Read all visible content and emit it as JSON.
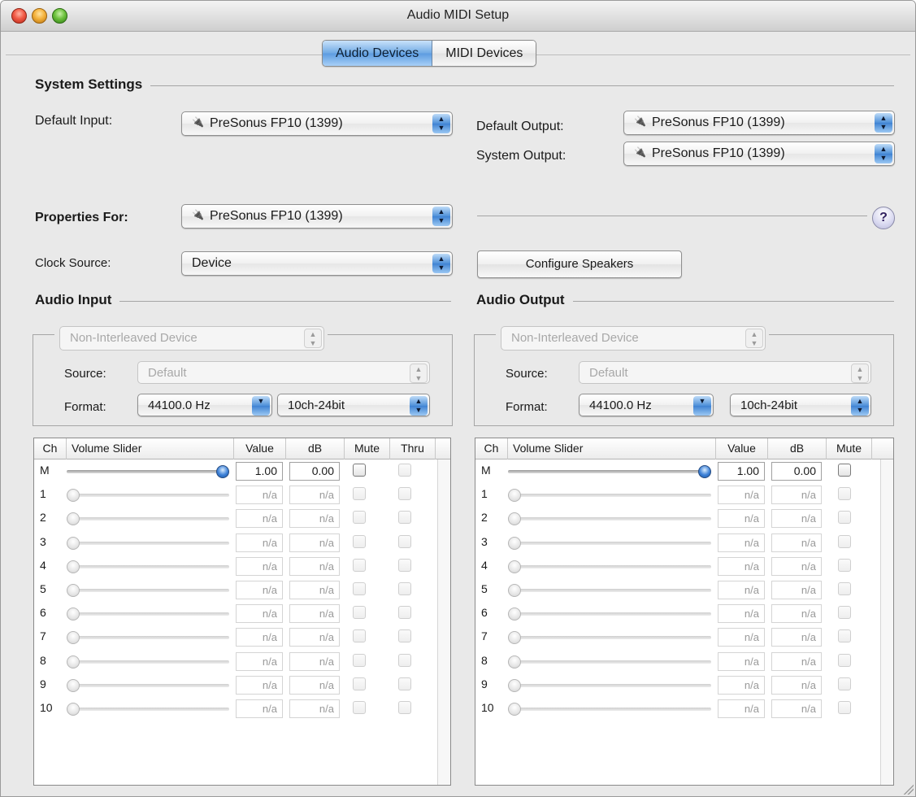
{
  "window": {
    "title": "Audio MIDI Setup"
  },
  "tabs": [
    {
      "label": "Audio Devices"
    },
    {
      "label": "MIDI Devices"
    }
  ],
  "system_settings": {
    "heading": "System Settings",
    "default_input": {
      "label": "Default Input:",
      "value": "PreSonus FP10 (1399)"
    },
    "default_output": {
      "label": "Default Output:",
      "value": "PreSonus FP10 (1399)"
    },
    "system_output": {
      "label": "System Output:",
      "value": "PreSonus FP10 (1399)"
    }
  },
  "properties": {
    "label": "Properties For:",
    "value": "PreSonus FP10 (1399)",
    "help": "?",
    "clock_label": "Clock Source:",
    "clock_value": "Device",
    "configure_button": "Configure Speakers"
  },
  "audio_input": {
    "heading": "Audio Input",
    "mode": "Non-Interleaved Device",
    "source_label": "Source:",
    "source_value": "Default",
    "format_label": "Format:",
    "rate": "44100.0 Hz",
    "bits": "10ch-24bit",
    "columns": {
      "ch": "Ch",
      "slider": "Volume Slider",
      "value": "Value",
      "db": "dB",
      "mute": "Mute",
      "thru": "Thru"
    }
  },
  "audio_output": {
    "heading": "Audio Output",
    "mode": "Non-Interleaved Device",
    "source_label": "Source:",
    "source_value": "Default",
    "format_label": "Format:",
    "rate": "44100.0 Hz",
    "bits": "10ch-24bit",
    "columns": {
      "ch": "Ch",
      "slider": "Volume Slider",
      "value": "Value",
      "db": "dB",
      "mute": "Mute"
    }
  },
  "channels": [
    {
      "ch": "M",
      "value": "1.00",
      "db": "0.00",
      "level": 1.0,
      "enabled": true
    },
    {
      "ch": "1",
      "value": "n/a",
      "db": "n/a",
      "level": 0.0,
      "enabled": false
    },
    {
      "ch": "2",
      "value": "n/a",
      "db": "n/a",
      "level": 0.0,
      "enabled": false
    },
    {
      "ch": "3",
      "value": "n/a",
      "db": "n/a",
      "level": 0.0,
      "enabled": false
    },
    {
      "ch": "4",
      "value": "n/a",
      "db": "n/a",
      "level": 0.0,
      "enabled": false
    },
    {
      "ch": "5",
      "value": "n/a",
      "db": "n/a",
      "level": 0.0,
      "enabled": false
    },
    {
      "ch": "6",
      "value": "n/a",
      "db": "n/a",
      "level": 0.0,
      "enabled": false
    },
    {
      "ch": "7",
      "value": "n/a",
      "db": "n/a",
      "level": 0.0,
      "enabled": false
    },
    {
      "ch": "8",
      "value": "n/a",
      "db": "n/a",
      "level": 0.0,
      "enabled": false
    },
    {
      "ch": "9",
      "value": "n/a",
      "db": "n/a",
      "level": 0.0,
      "enabled": false
    },
    {
      "ch": "10",
      "value": "n/a",
      "db": "n/a",
      "level": 0.0,
      "enabled": false
    }
  ]
}
